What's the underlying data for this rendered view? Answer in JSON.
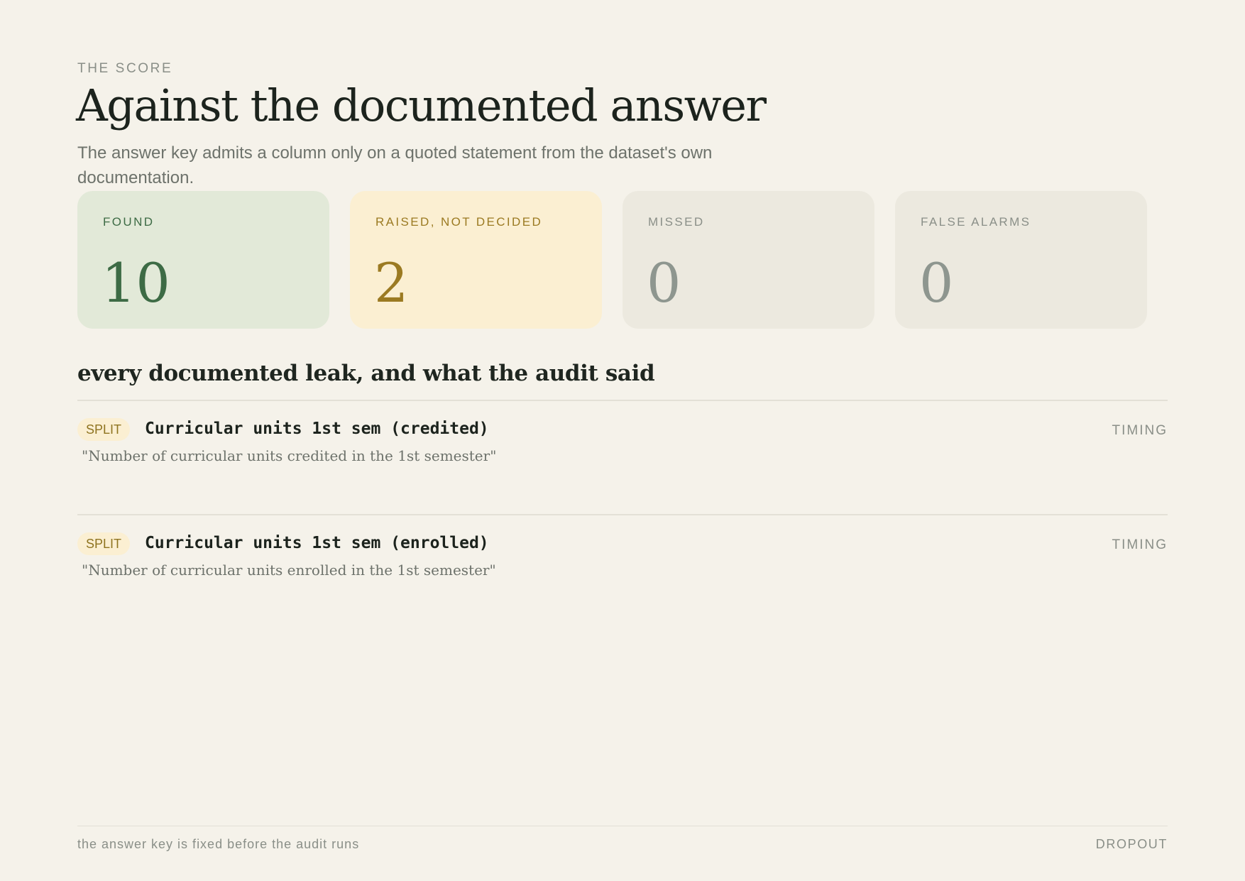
{
  "header": {
    "eyebrow": "THE SCORE",
    "title": "Against the documented answer",
    "subtitle": "The answer key admits a column only on a quoted statement from the dataset's own documentation."
  },
  "score_cards": [
    {
      "label": "FOUND",
      "value": "10",
      "color": "#3d6b45",
      "background": "#e2e9d8"
    },
    {
      "label": "RAISED, NOT DECIDED",
      "value": "2",
      "color": "#9b7a22",
      "background": "#fbefd2"
    },
    {
      "label": "MISSED",
      "value": "0",
      "color": "#8e968f",
      "background": "#ece9df"
    },
    {
      "label": "FALSE ALARMS",
      "value": "0",
      "color": "#8e968f",
      "background": "#ece9df"
    }
  ],
  "leaks": {
    "section_title": "every documented leak, and what the audit said",
    "rows": [
      {
        "verdict": "SPLIT",
        "column": "Curricular units 1st sem (credited)",
        "quote": "\"Number of curricular units credited in the 1st semester\"",
        "type": "TIMING"
      },
      {
        "verdict": "SPLIT",
        "column": "Curricular units 1st sem (enrolled)",
        "quote": "\"Number of curricular units enrolled in the 1st semester\"",
        "type": "TIMING"
      }
    ]
  },
  "footer": {
    "note": "the answer key is fixed before the audit runs",
    "dataset": "DROPOUT"
  }
}
